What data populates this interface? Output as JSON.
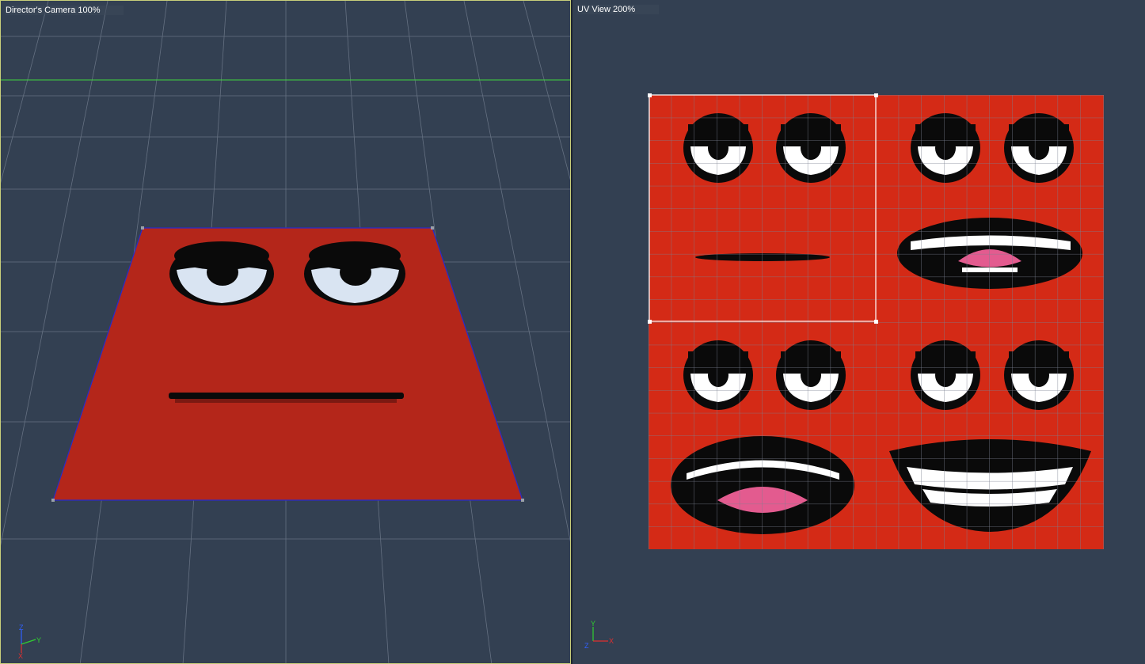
{
  "viewports": {
    "left": {
      "title": "Director's Camera 100%"
    },
    "right": {
      "title": "UV View 200%"
    }
  },
  "axes": {
    "left": {
      "up": "Z",
      "right": "Y",
      "origin": "X"
    },
    "right": {
      "up": "Y",
      "right": "X",
      "origin": "Z"
    }
  },
  "colors": {
    "background": "#334052",
    "grid": "#7a8596",
    "plane_red": "#b4261a",
    "texture_red": "#d42a16",
    "horizon_line": "#3fd43f",
    "plane_edge": "#2a2ac8",
    "axis_x": "#e03030",
    "axis_y": "#30d030",
    "axis_z": "#3060ff"
  }
}
